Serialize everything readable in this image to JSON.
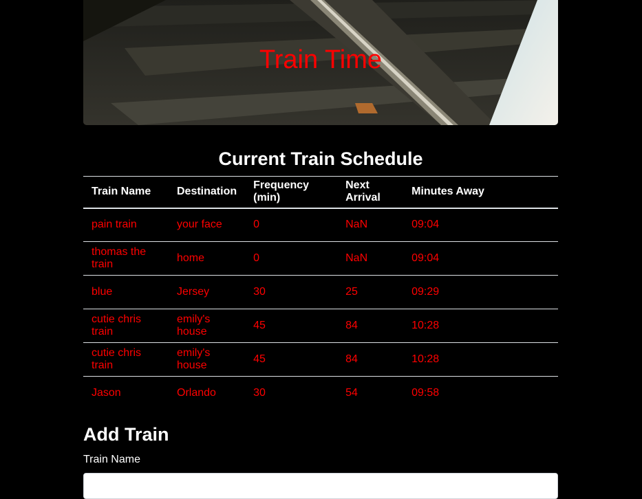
{
  "header": {
    "title": "Train Time",
    "title_color": "#ff0000"
  },
  "schedule": {
    "title": "Current Train Schedule",
    "columns": [
      "Train Name",
      "Destination",
      "Frequency (min)",
      "Next Arrival",
      "Minutes Away"
    ],
    "rows": [
      {
        "name": "pain train",
        "destination": "your face",
        "frequency": "0",
        "next_arrival": "NaN",
        "minutes_away": "09:04"
      },
      {
        "name": "thomas the train",
        "destination": "home",
        "frequency": "0",
        "next_arrival": "NaN",
        "minutes_away": "09:04"
      },
      {
        "name": "blue",
        "destination": "Jersey",
        "frequency": "30",
        "next_arrival": "25",
        "minutes_away": "09:29"
      },
      {
        "name": "cutie chris train",
        "destination": "emily's house",
        "frequency": "45",
        "next_arrival": "84",
        "minutes_away": "10:28"
      },
      {
        "name": "cutie chris train",
        "destination": "emily's house",
        "frequency": "45",
        "next_arrival": "84",
        "minutes_away": "10:28"
      },
      {
        "name": "Jason",
        "destination": "Orlando",
        "frequency": "30",
        "next_arrival": "54",
        "minutes_away": "09:58"
      }
    ],
    "cell_color": "#ff0000"
  },
  "add_train": {
    "title": "Add Train",
    "name_label": "Train Name",
    "name_value": "",
    "name_placeholder": ""
  }
}
